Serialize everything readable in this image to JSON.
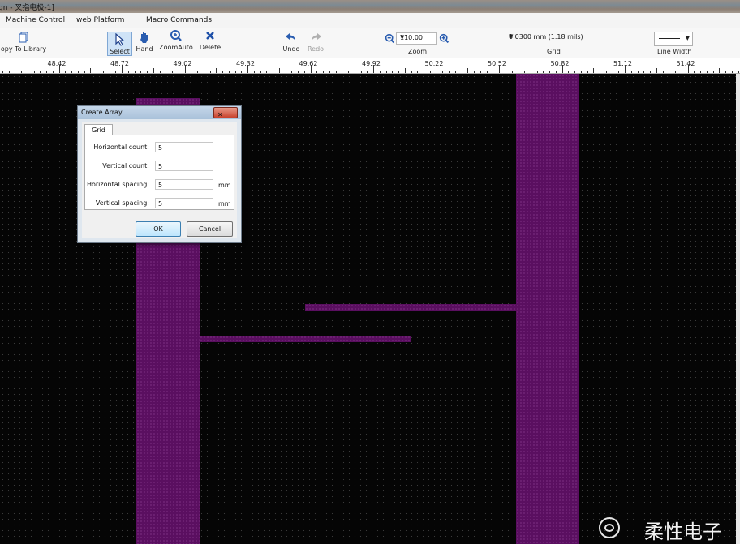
{
  "window": {
    "title": "gn - 叉指电极-1]"
  },
  "menu": [
    "Machine Control",
    "web Platform",
    "Macro Commands"
  ],
  "toolbar": {
    "copy_to_library": "opy To Library",
    "select": "Select",
    "hand": "Hand",
    "zoom_auto": "ZoomAuto",
    "delete": "Delete",
    "undo": "Undo",
    "redo": "Redo",
    "zoom_value": "110.00",
    "zoom_group": "Zoom",
    "grid_value": "0.0300 mm (1.18 mils)",
    "grid_group": "Grid",
    "line_width_group": "Line Width"
  },
  "ruler": {
    "labels": [
      "48.42",
      "48.72",
      "49.02",
      "49.32",
      "49.62",
      "49.92",
      "50.22",
      "50.52",
      "50.82",
      "51.12",
      "51.42"
    ]
  },
  "dialog": {
    "title": "Create Array",
    "close_glyph": "✕",
    "tab": "Grid",
    "fields": [
      {
        "label": "Horizontal count:",
        "value": "5",
        "unit": ""
      },
      {
        "label": "Vertical count:",
        "value": "5",
        "unit": ""
      },
      {
        "label": "Horizontal spacing:",
        "value": "5",
        "unit": "mm"
      },
      {
        "label": "Vertical spacing:",
        "value": "5",
        "unit": "mm"
      }
    ],
    "ok": "OK",
    "cancel": "Cancel"
  },
  "watermark": {
    "text": "柔性电子"
  },
  "colors": {
    "trace": "#5a0f60",
    "canvas": "#050505",
    "dialog_bg": "#f0f0f0"
  }
}
